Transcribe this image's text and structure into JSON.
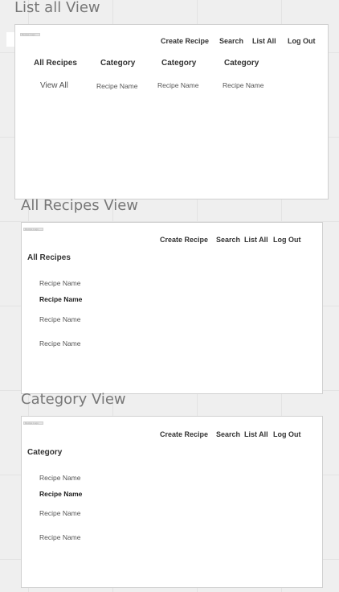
{
  "sections": {
    "list_all": {
      "title": "List all View",
      "logo_text": "Recipe Logo",
      "nav": [
        "Create Recipe",
        "Search",
        "List All",
        "Log Out"
      ],
      "columns": [
        "All Recipes",
        "Category",
        "Category",
        "Category"
      ],
      "row": [
        "View All",
        "Recipe Name",
        "Recipe Name",
        "Recipe Name"
      ]
    },
    "all_recipes": {
      "title": "All Recipes  View",
      "logo_text": "Recipe Logo",
      "nav": [
        "Create Recipe",
        "Search",
        "List All",
        "Log Out"
      ],
      "heading": "All Recipes",
      "items": [
        "Recipe Name",
        "Recipe Name",
        "Recipe Name",
        "Recipe Name"
      ]
    },
    "category": {
      "title": "Category  View",
      "logo_text": "Recipe Logo",
      "nav": [
        "Create Recipe",
        "Search",
        "List All",
        "Log Out"
      ],
      "heading": "Category",
      "items": [
        "Recipe Name",
        "Recipe Name",
        "Recipe Name",
        "Recipe Name"
      ]
    }
  }
}
